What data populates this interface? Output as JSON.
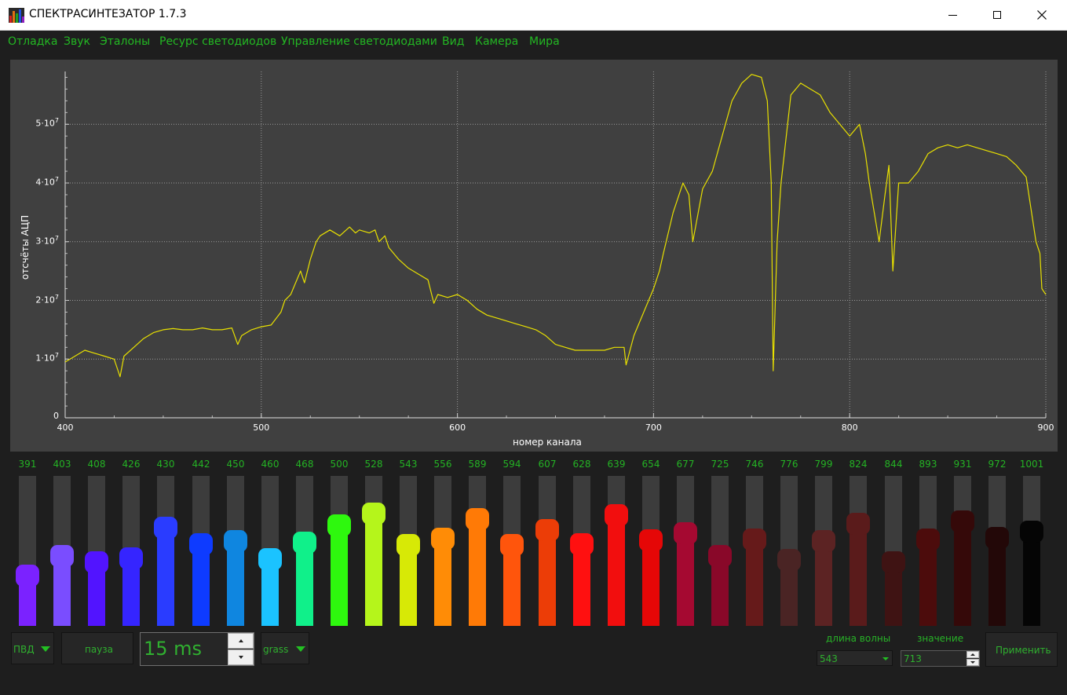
{
  "window": {
    "title": "СПЕКТРАСИНТЕЗАТОР 1.7.3",
    "minimize_icon": "minimize-icon",
    "maximize_icon": "maximize-icon",
    "close_icon": "close-icon"
  },
  "menu": {
    "items": [
      "Отладка",
      "Звук",
      "Эталоны",
      "Ресурс светодиодов",
      "Управление светодиодами",
      "Вид",
      "Камера",
      "Мира"
    ]
  },
  "chart_data": {
    "type": "line",
    "xlabel": "номер канала",
    "ylabel": "отсчёты АЦП",
    "xlim": [
      400,
      900
    ],
    "ylim": [
      0,
      59000000
    ],
    "x_ticks": [
      "400",
      "500",
      "600",
      "700",
      "800",
      "900"
    ],
    "y_ticks": [
      {
        "value": 0,
        "mantissa": "0",
        "exp": ""
      },
      {
        "value": 10000000,
        "mantissa": "1·10",
        "exp": "7"
      },
      {
        "value": 20000000,
        "mantissa": "2·10",
        "exp": "7"
      },
      {
        "value": 30000000,
        "mantissa": "3·10",
        "exp": "7"
      },
      {
        "value": 40000000,
        "mantissa": "4·10",
        "exp": "7"
      },
      {
        "value": 50000000,
        "mantissa": "5·10",
        "exp": "7"
      }
    ],
    "grid": true,
    "line_color": "#e8e000",
    "series": [
      {
        "x": [
          400,
          405,
          410,
          415,
          420,
          425,
          428,
          430,
          435,
          440,
          445,
          450,
          455,
          460,
          465,
          470,
          475,
          480,
          485,
          488,
          490,
          495,
          500,
          505,
          510,
          512,
          515,
          520,
          522,
          525,
          528,
          530,
          535,
          540,
          545,
          548,
          550,
          555,
          558,
          560,
          563,
          565,
          570,
          575,
          580,
          585,
          588,
          590,
          595,
          600,
          605,
          610,
          615,
          620,
          625,
          630,
          635,
          640,
          645,
          650,
          655,
          660,
          665,
          670,
          675,
          680,
          685,
          686,
          688,
          690,
          695,
          700,
          703,
          705,
          710,
          715,
          718,
          720,
          725,
          730,
          735,
          740,
          745,
          750,
          755,
          758,
          760,
          761,
          763,
          765,
          770,
          775,
          780,
          785,
          790,
          795,
          800,
          805,
          808,
          810,
          815,
          818,
          820,
          822,
          825,
          830,
          835,
          840,
          845,
          850,
          855,
          860,
          865,
          870,
          875,
          880,
          885,
          890,
          895,
          897,
          898,
          900
        ],
        "y": [
          9500000,
          10500000,
          11500000,
          11000000,
          10500000,
          10000000,
          7000000,
          10500000,
          12000000,
          13500000,
          14500000,
          15000000,
          15200000,
          15000000,
          15000000,
          15300000,
          15000000,
          15000000,
          15300000,
          12500000,
          14000000,
          15000000,
          15500000,
          15800000,
          18000000,
          20000000,
          21000000,
          25000000,
          23000000,
          27000000,
          30000000,
          31000000,
          32000000,
          31000000,
          32500000,
          31500000,
          32000000,
          31500000,
          32000000,
          30000000,
          31000000,
          29000000,
          27000000,
          25500000,
          24500000,
          23500000,
          19500000,
          21000000,
          20500000,
          21000000,
          20000000,
          18500000,
          17500000,
          17000000,
          16500000,
          16000000,
          15500000,
          15000000,
          14000000,
          12500000,
          12000000,
          11500000,
          11500000,
          11500000,
          11500000,
          12000000,
          12000000,
          9000000,
          11500000,
          14000000,
          18000000,
          22000000,
          25000000,
          28000000,
          35000000,
          40000000,
          38000000,
          30000000,
          39000000,
          42000000,
          48000000,
          54000000,
          57000000,
          58500000,
          58000000,
          54000000,
          40000000,
          8000000,
          30000000,
          40000000,
          55000000,
          57000000,
          56000000,
          55000000,
          52000000,
          50000000,
          48000000,
          50000000,
          45000000,
          40000000,
          30000000,
          38000000,
          43000000,
          25000000,
          40000000,
          40000000,
          42000000,
          45000000,
          46000000,
          46500000,
          46000000,
          46500000,
          46000000,
          45500000,
          45000000,
          44500000,
          43000000,
          41000000,
          30000000,
          28000000,
          22000000,
          21000000
        ]
      }
    ]
  },
  "sliders": [
    {
      "label": "391",
      "level": 0.304,
      "color": "#7b22ff"
    },
    {
      "label": "403",
      "level": 0.46,
      "color": "#7a4dff"
    },
    {
      "label": "408",
      "level": 0.414,
      "color": "#5214ff"
    },
    {
      "label": "426",
      "level": 0.44,
      "color": "#3525ff"
    },
    {
      "label": "430",
      "level": 0.681,
      "color": "#2a3cff"
    },
    {
      "label": "442",
      "level": 0.555,
      "color": "#0e3bff"
    },
    {
      "label": "450",
      "level": 0.578,
      "color": "#0f86e0"
    },
    {
      "label": "460",
      "level": 0.434,
      "color": "#1bc3ff"
    },
    {
      "label": "468",
      "level": 0.565,
      "color": "#10f08a"
    },
    {
      "label": "500",
      "level": 0.702,
      "color": "#2ef80e"
    },
    {
      "label": "528",
      "level": 0.791,
      "color": "#b5f51b"
    },
    {
      "label": "543",
      "level": 0.545,
      "color": "#d7e906"
    },
    {
      "label": "556",
      "level": 0.597,
      "color": "#ff8c06"
    },
    {
      "label": "589",
      "level": 0.749,
      "color": "#ff7a06"
    },
    {
      "label": "594",
      "level": 0.545,
      "color": "#ff550c"
    },
    {
      "label": "607",
      "level": 0.665,
      "color": "#ec3d07"
    },
    {
      "label": "628",
      "level": 0.55,
      "color": "#ff1010"
    },
    {
      "label": "639",
      "level": 0.78,
      "color": "#f20e0e"
    },
    {
      "label": "654",
      "level": 0.581,
      "color": "#e50707"
    },
    {
      "label": "677",
      "level": 0.639,
      "color": "#a50931"
    },
    {
      "label": "725",
      "level": 0.461,
      "color": "#890829"
    },
    {
      "label": "746",
      "level": 0.592,
      "color": "#661a1a"
    },
    {
      "label": "776",
      "level": 0.429,
      "color": "#4a2424"
    },
    {
      "label": "799",
      "level": 0.576,
      "color": "#5c2323"
    },
    {
      "label": "824",
      "level": 0.712,
      "color": "#5a1b1b"
    },
    {
      "label": "844",
      "level": 0.414,
      "color": "#3f1313"
    },
    {
      "label": "893",
      "level": 0.586,
      "color": "#4c0c0c"
    },
    {
      "label": "931",
      "level": 0.728,
      "color": "#350909"
    },
    {
      "label": "972",
      "level": 0.603,
      "color": "#230808"
    },
    {
      "label": "1001",
      "level": 0.649,
      "color": "#050505"
    }
  ],
  "controls": {
    "mode_select": "ПВД",
    "pause_button": "пауза",
    "interval_value": "15 ms",
    "spin_up_icon": "triangle-up-icon",
    "spin_down_icon": "triangle-down-icon",
    "palette_select": "grass",
    "wavelength_label": "длина волны",
    "wavelength_value": "543",
    "value_label": "значение",
    "value_value": "713",
    "apply_button": "Применить"
  }
}
